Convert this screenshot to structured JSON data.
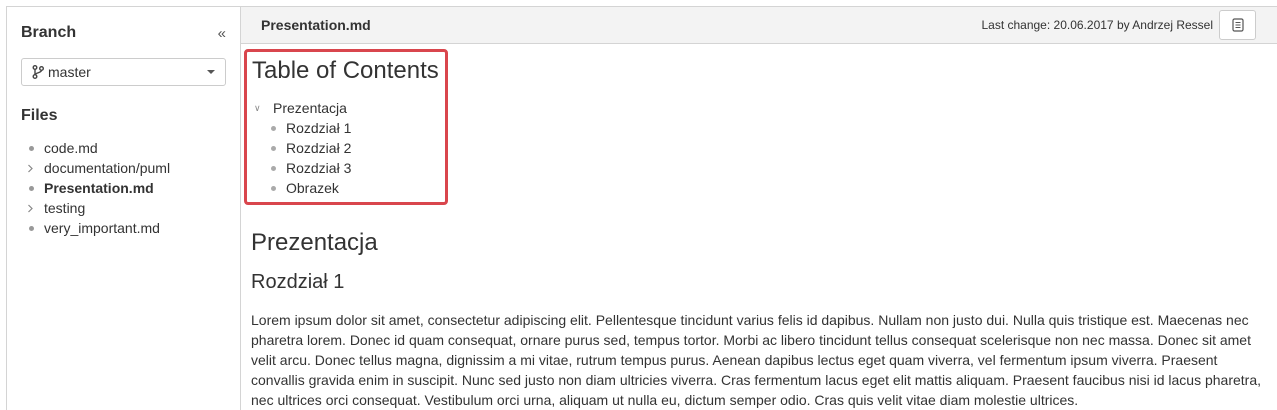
{
  "sidebar": {
    "branch_title": "Branch",
    "collapse_glyph": "«",
    "branch_selected": "master",
    "files_title": "Files",
    "files": [
      {
        "name": "code.md",
        "kind": "file",
        "active": false
      },
      {
        "name": "documentation/puml",
        "kind": "folder",
        "active": false
      },
      {
        "name": "Presentation.md",
        "kind": "file",
        "active": true
      },
      {
        "name": "testing",
        "kind": "folder",
        "active": false
      },
      {
        "name": "very_important.md",
        "kind": "file",
        "active": false
      }
    ]
  },
  "header": {
    "doc_title": "Presentation.md",
    "last_change_label": "Last change:",
    "last_change_date": "20.06.2017",
    "by_label": "by",
    "author": "Andrzej Ressel"
  },
  "toc": {
    "title": "Table of Contents",
    "root": "Prezentacja",
    "items": [
      "Rozdział 1",
      "Rozdział 2",
      "Rozdział 3",
      "Obrazek"
    ]
  },
  "document": {
    "h1": "Prezentacja",
    "h2": "Rozdział 1",
    "paragraph": "Lorem ipsum dolor sit amet, consectetur adipiscing elit. Pellentesque tincidunt varius felis id dapibus. Nullam non justo dui. Nulla quis tristique est. Maecenas nec pharetra lorem. Donec id quam consequat, ornare purus sed, tempus tortor. Morbi ac libero tincidunt tellus consequat scelerisque non nec massa. Donec sit amet velit arcu. Donec tellus magna, dignissim a mi vitae, rutrum tempus purus. Aenean dapibus lectus eget quam viverra, vel fermentum ipsum viverra. Praesent convallis gravida enim in suscipit. Nunc sed justo non diam ultricies viverra. Cras fermentum lacus eget elit mattis aliquam. Praesent faucibus nisi id lacus pharetra, nec ultrices orci consequat. Vestibulum orci urna, aliquam ut nulla eu, dictum semper odio. Cras quis velit vitae diam molestie ultrices."
  },
  "colors": {
    "toc_highlight": "#d9464d",
    "topbar_bg": "#f3f3f3",
    "border": "#d4d4d4"
  },
  "icons": {
    "branch": "git-branch-icon",
    "dropdown": "caret-down-icon",
    "folder": "chevron-right-icon",
    "file": "bullet-icon",
    "toc_expand": "chevron-down-icon",
    "doc_button": "document-icon"
  }
}
